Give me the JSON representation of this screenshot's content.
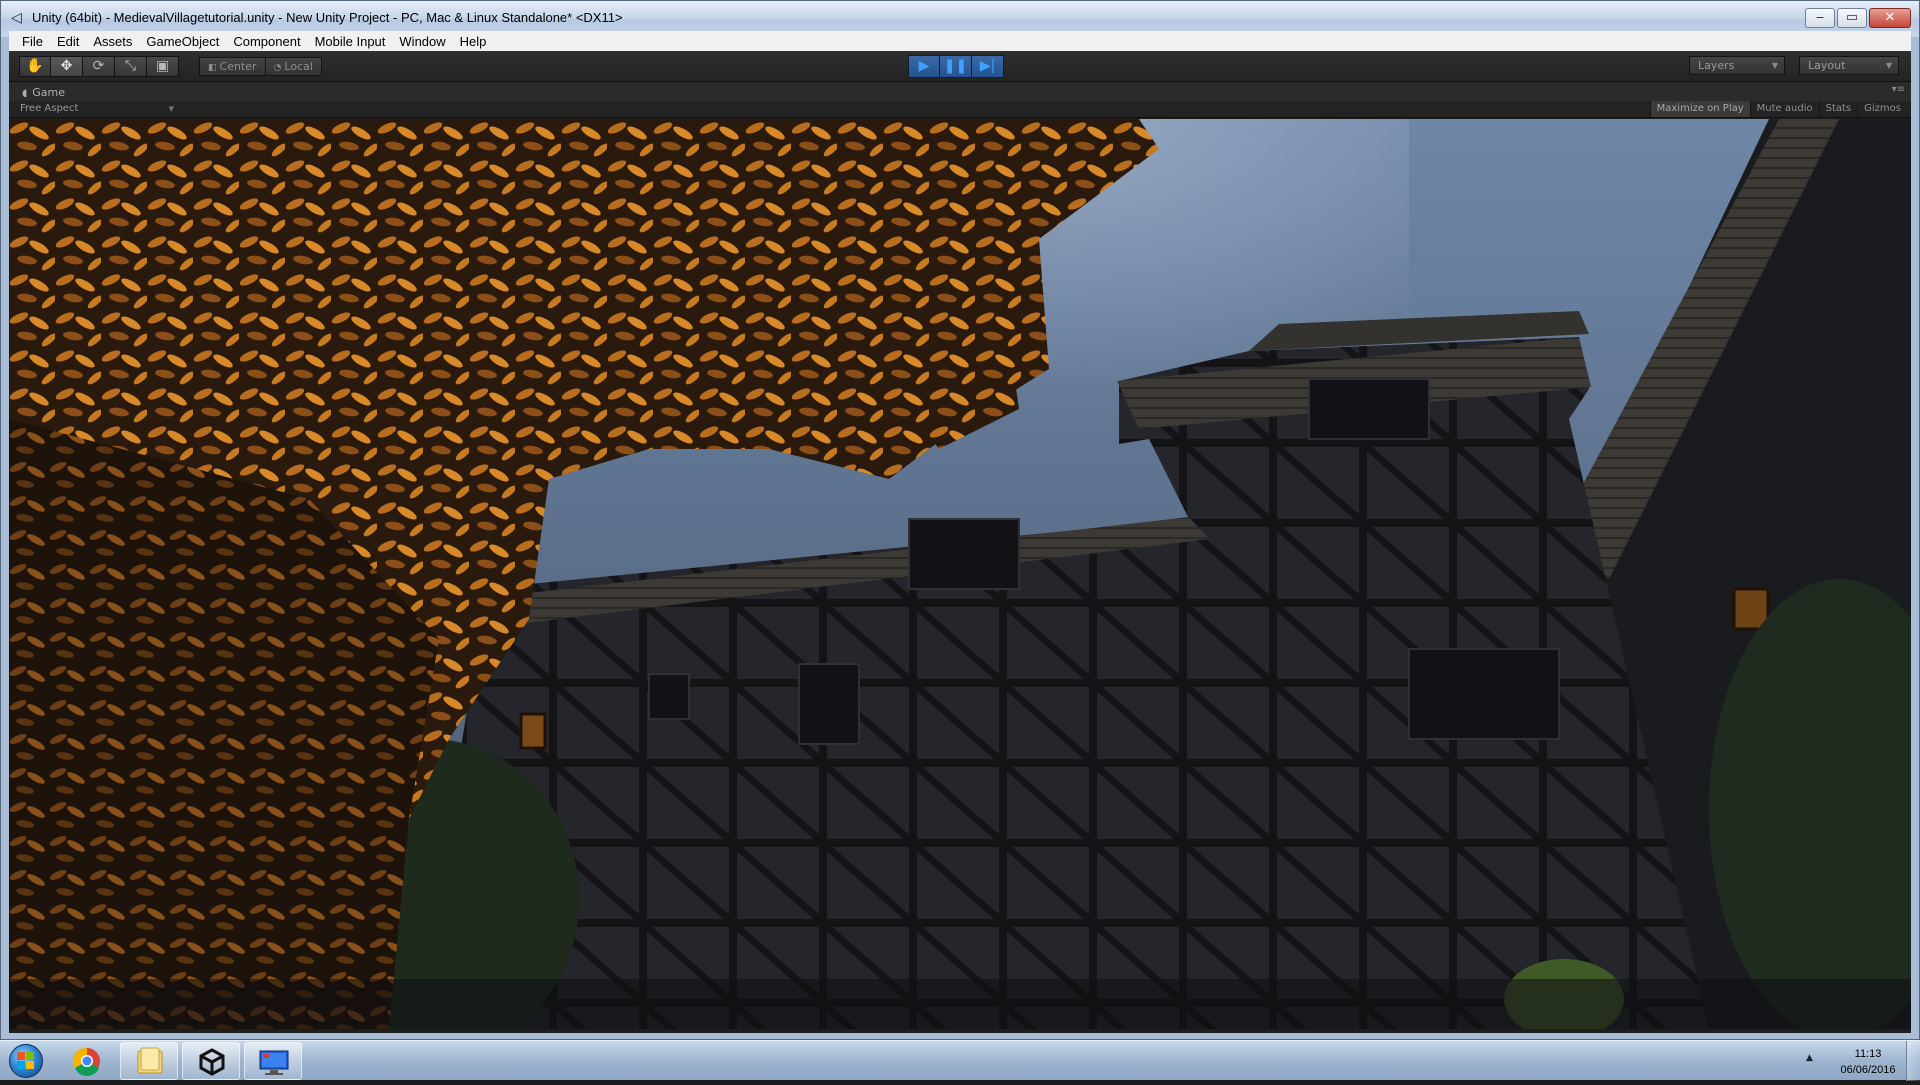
{
  "window": {
    "title": "Unity (64bit) - MedievalVillagetutorial.unity - New Unity Project - PC, Mac & Linux Standalone* <DX11>",
    "controls": {
      "minimize": "‒",
      "maximize": "▭",
      "close": "✕"
    }
  },
  "menu": [
    "File",
    "Edit",
    "Assets",
    "GameObject",
    "Component",
    "Mobile Input",
    "Window",
    "Help"
  ],
  "toolbar": {
    "tools": [
      "hand-icon",
      "move-icon",
      "rotate-icon",
      "scale-icon",
      "rect-icon"
    ],
    "pivot_mode": "Center",
    "pivot_rotation": "Local",
    "play_state": "playing",
    "layers_label": "Layers",
    "layout_label": "Layout"
  },
  "game_view": {
    "tab_label": "Game",
    "aspect": "Free Aspect",
    "options": [
      {
        "label": "Maximize on Play",
        "active": true
      },
      {
        "label": "Mute audio",
        "active": false
      },
      {
        "label": "Stats",
        "active": false
      },
      {
        "label": "Gizmos",
        "active": false
      }
    ]
  },
  "taskbar": {
    "apps": [
      "chrome-icon",
      "file-explorer-icon",
      "unity-icon",
      "remote-desktop-icon"
    ],
    "time": "11:13",
    "date": "06/06/2016"
  },
  "colors": {
    "play_accent": "#3fa0ff",
    "editor_dark": "#1e1e1e",
    "sky": "#5b6f8a",
    "foliage_orange": "#c67a22",
    "building_dark": "#1c1d21"
  }
}
